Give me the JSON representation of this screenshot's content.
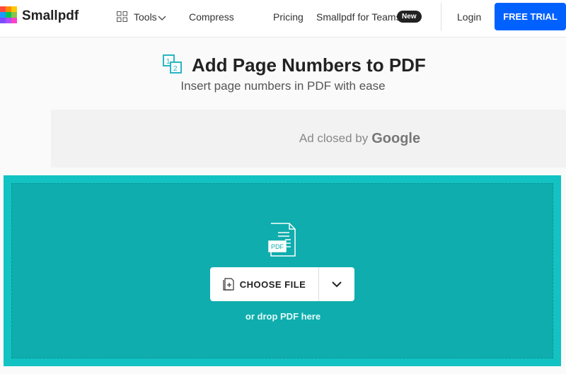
{
  "nav": {
    "brand": "Smallpdf",
    "tools": "Tools",
    "compress": "Compress",
    "pricing": "Pricing",
    "teams": "Smallpdf for Teams",
    "new_badge": "New",
    "login": "Login",
    "trial": "FREE TRIAL"
  },
  "header": {
    "title": "Add Page Numbers to PDF",
    "subtitle": "Insert page numbers in PDF with ease"
  },
  "ad": {
    "text": "Ad closed by",
    "brand": "Google"
  },
  "upload": {
    "choose": "CHOOSE FILE",
    "drop": "or drop PDF here",
    "file_badge": "PDF"
  },
  "colors": {
    "accent": "#13c2c3",
    "trial": "#0061fe"
  }
}
